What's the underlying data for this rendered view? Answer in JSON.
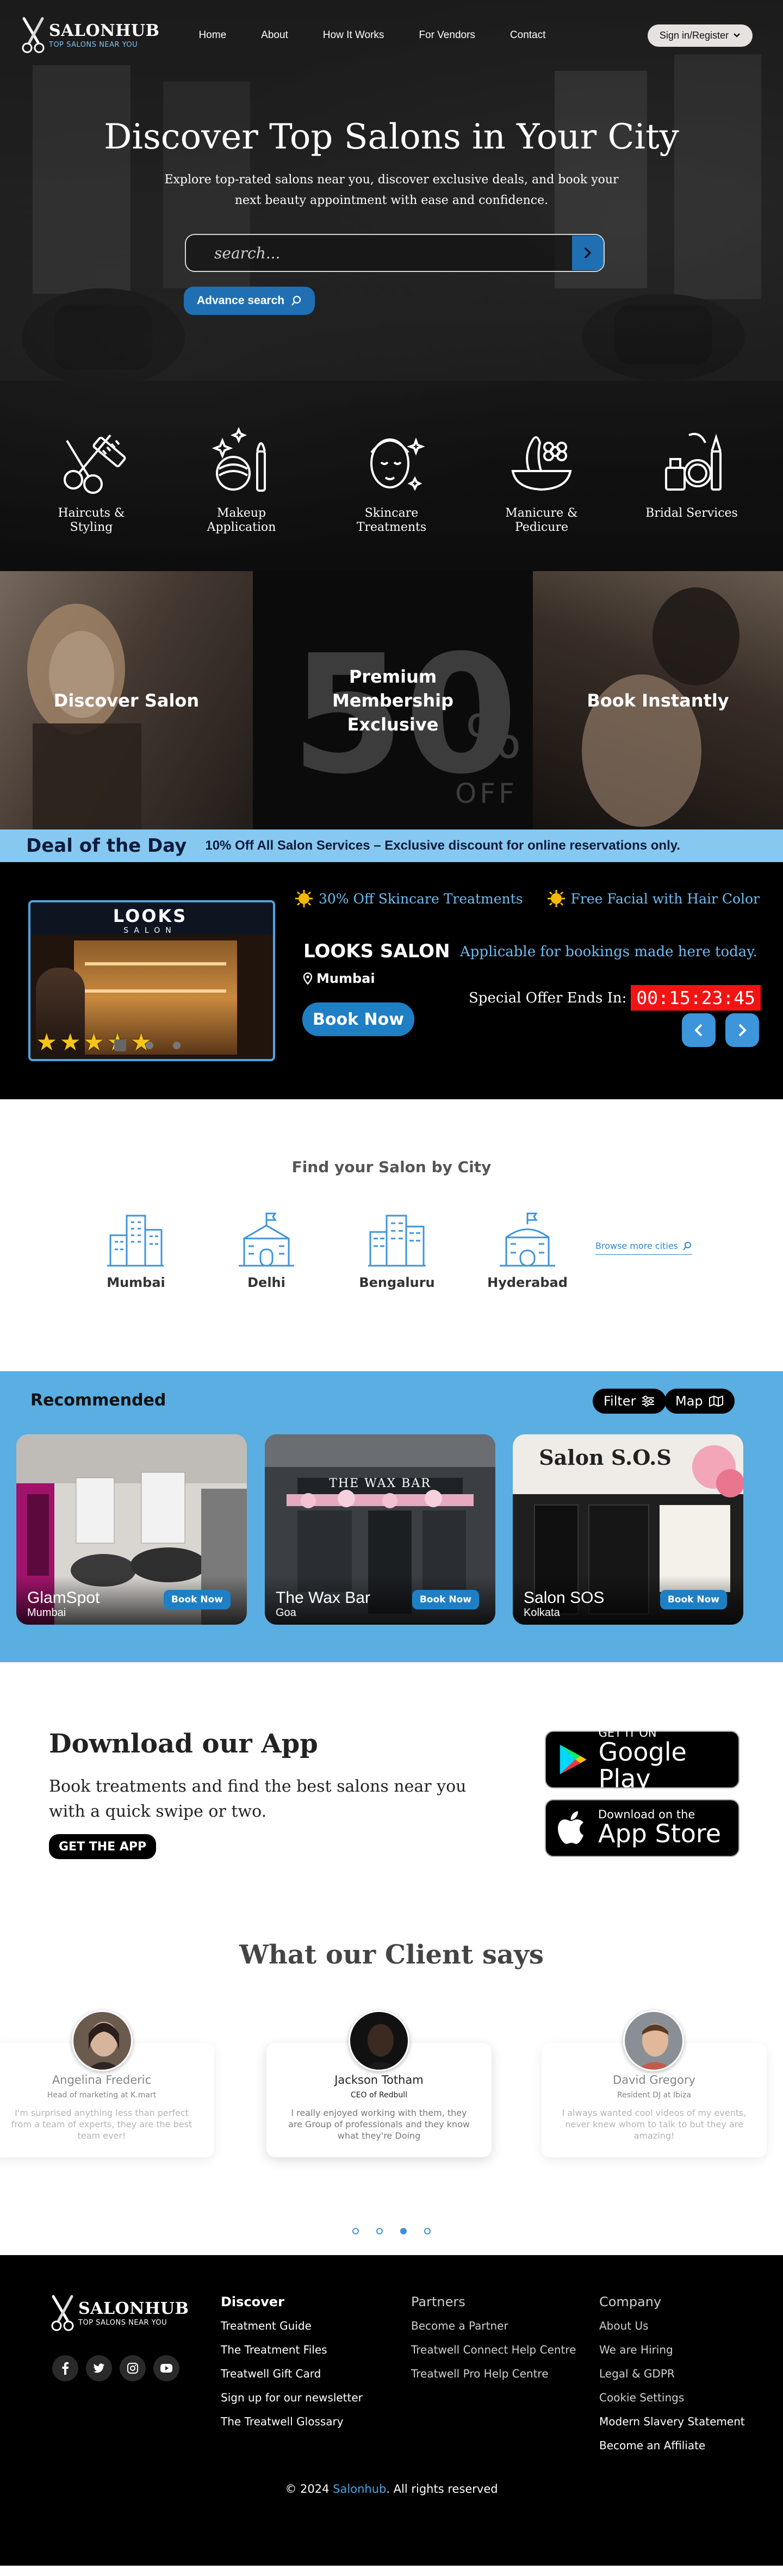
{
  "brand": {
    "name": "SALONHUB",
    "tagline": "TOP SALONS NEAR YOU"
  },
  "nav": {
    "links": [
      "Home",
      "About",
      "How It Works",
      "For Vendors",
      "Contact"
    ],
    "signin_label": "Sign in/Register"
  },
  "hero": {
    "title": "Discover Top Salons in Your City",
    "subtitle": "Explore top-rated salons near you, discover exclusive deals, and book your next beauty appointment with ease and confidence.",
    "search_placeholder": "search...",
    "advanced_search_label": "Advance search"
  },
  "services": [
    {
      "label": "Haircuts & Styling",
      "icon": "scissors-comb-icon"
    },
    {
      "label": "Makeup Application",
      "icon": "makeup-brush-icon"
    },
    {
      "label": "Skincare Treatments",
      "icon": "face-care-icon"
    },
    {
      "label": "Manicure & Pedicure",
      "icon": "nail-bowl-icon"
    },
    {
      "label": "Bridal Services",
      "icon": "cosmetics-icon"
    }
  ],
  "promo": {
    "left": "Discover Salon",
    "mid": "Premium Membership Exclusive",
    "mid_bg_number": "50",
    "mid_bg_percent": "%",
    "mid_bg_off": "OFF",
    "right": "Book Instantly"
  },
  "deal": {
    "title": "Deal of the Day",
    "description": "10% Off All Salon Services – Exclusive discount for online reservations only.",
    "offers": [
      "30% Off Skincare Treatments",
      "Free Facial with Hair Color"
    ],
    "salon_name": "LOOKS SALON",
    "city": "Mumbai",
    "store_sign_top": "LOOKS",
    "store_sign_bottom": "SALON",
    "rating": 5,
    "book_label": "Book Now",
    "applicable": "Applicable for bookings made here today.",
    "ends_label": "Special Offer Ends In:",
    "countdown": "00:15:23:45"
  },
  "cities": {
    "title": "Find your Salon by City",
    "items": [
      "Mumbai",
      "Delhi",
      "Bengaluru",
      "Hyderabad"
    ],
    "browse_more": "Browse more cities"
  },
  "recommended": {
    "title": "Recommended",
    "filter_label": "Filter",
    "map_label": "Map",
    "book_label": "Book Now",
    "salons": [
      {
        "name": "GlamSpot",
        "city": "Mumbai"
      },
      {
        "name": "The Wax Bar",
        "city": "Goa",
        "sign": "THE WAX BAR"
      },
      {
        "name": "Salon SOS",
        "city": "Kolkata",
        "sign": "Salon S.O.S"
      }
    ]
  },
  "app": {
    "title": "Download our App",
    "description": "Book treatments and find the best salons near you with a quick swipe or two.",
    "cta": "GET THE APP",
    "google_small": "GET IT ON",
    "google_big": "Google Play",
    "apple_small": "Download on the",
    "apple_big": "App Store"
  },
  "testimonials": {
    "title": "What our Client says",
    "items": [
      {
        "name": "Angelina Frederic",
        "role": "Head of marketing at K.mart",
        "quote": "I'm surprised anything less than perfect from a team of experts, they are the best team ever!"
      },
      {
        "name": "Jackson Totham",
        "role": "CEO of Redbull",
        "quote": "I really enjoyed working with them, they are Group of professionals and they know what they're Doing"
      },
      {
        "name": "David Gregory",
        "role": "Resident DJ at Ibiza",
        "quote": "I always wanted cool videos of my events, never knew whom to talk to but they are amazing!"
      }
    ],
    "dot_count": 4,
    "active_dot": 2
  },
  "footer": {
    "discover": {
      "title": "Discover",
      "links": [
        "Treatment Guide",
        "The Treatment Files",
        "Treatwell Gift Card",
        "Sign up for our newsletter",
        "The Treatwell Glossary"
      ]
    },
    "partners": {
      "title": "Partners",
      "links": [
        "Become a Partner",
        "Treatwell Connect Help Centre",
        "Treatwell Pro Help Centre"
      ]
    },
    "company": {
      "title": "Company",
      "links": [
        "About Us",
        "We are Hiring",
        "Legal & GDPR",
        "Cookie Settings",
        "Modern Slavery Statement",
        "Become an Affiliate"
      ]
    },
    "socials": [
      "facebook-icon",
      "twitter-icon",
      "instagram-icon",
      "youtube-icon"
    ],
    "copyright_prefix": "© 2024",
    "copyright_brand": "Salonhub",
    "copyright_suffix": ". All rights reserved"
  },
  "colors": {
    "accent_blue": "#1f7fc4",
    "light_blue": "#87c8f1",
    "recommended_bg": "#5aaee2",
    "countdown_red": "#f21313"
  }
}
